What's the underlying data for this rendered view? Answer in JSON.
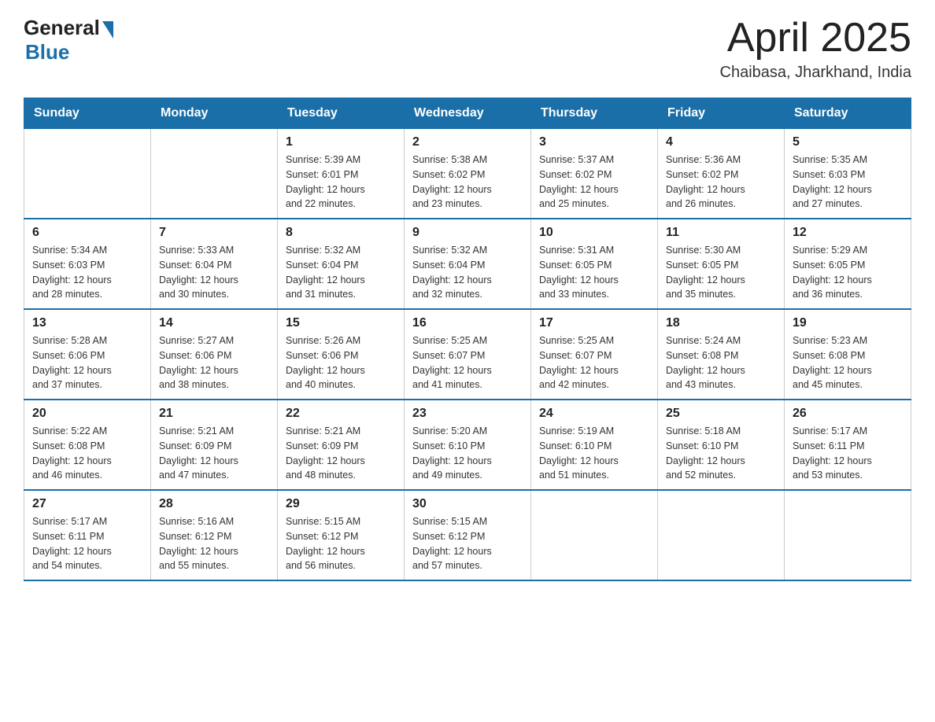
{
  "header": {
    "logo_general": "General",
    "logo_blue": "Blue",
    "month_year": "April 2025",
    "location": "Chaibasa, Jharkhand, India"
  },
  "weekdays": [
    "Sunday",
    "Monday",
    "Tuesday",
    "Wednesday",
    "Thursday",
    "Friday",
    "Saturday"
  ],
  "weeks": [
    [
      {
        "day": "",
        "info": ""
      },
      {
        "day": "",
        "info": ""
      },
      {
        "day": "1",
        "info": "Sunrise: 5:39 AM\nSunset: 6:01 PM\nDaylight: 12 hours\nand 22 minutes."
      },
      {
        "day": "2",
        "info": "Sunrise: 5:38 AM\nSunset: 6:02 PM\nDaylight: 12 hours\nand 23 minutes."
      },
      {
        "day": "3",
        "info": "Sunrise: 5:37 AM\nSunset: 6:02 PM\nDaylight: 12 hours\nand 25 minutes."
      },
      {
        "day": "4",
        "info": "Sunrise: 5:36 AM\nSunset: 6:02 PM\nDaylight: 12 hours\nand 26 minutes."
      },
      {
        "day": "5",
        "info": "Sunrise: 5:35 AM\nSunset: 6:03 PM\nDaylight: 12 hours\nand 27 minutes."
      }
    ],
    [
      {
        "day": "6",
        "info": "Sunrise: 5:34 AM\nSunset: 6:03 PM\nDaylight: 12 hours\nand 28 minutes."
      },
      {
        "day": "7",
        "info": "Sunrise: 5:33 AM\nSunset: 6:04 PM\nDaylight: 12 hours\nand 30 minutes."
      },
      {
        "day": "8",
        "info": "Sunrise: 5:32 AM\nSunset: 6:04 PM\nDaylight: 12 hours\nand 31 minutes."
      },
      {
        "day": "9",
        "info": "Sunrise: 5:32 AM\nSunset: 6:04 PM\nDaylight: 12 hours\nand 32 minutes."
      },
      {
        "day": "10",
        "info": "Sunrise: 5:31 AM\nSunset: 6:05 PM\nDaylight: 12 hours\nand 33 minutes."
      },
      {
        "day": "11",
        "info": "Sunrise: 5:30 AM\nSunset: 6:05 PM\nDaylight: 12 hours\nand 35 minutes."
      },
      {
        "day": "12",
        "info": "Sunrise: 5:29 AM\nSunset: 6:05 PM\nDaylight: 12 hours\nand 36 minutes."
      }
    ],
    [
      {
        "day": "13",
        "info": "Sunrise: 5:28 AM\nSunset: 6:06 PM\nDaylight: 12 hours\nand 37 minutes."
      },
      {
        "day": "14",
        "info": "Sunrise: 5:27 AM\nSunset: 6:06 PM\nDaylight: 12 hours\nand 38 minutes."
      },
      {
        "day": "15",
        "info": "Sunrise: 5:26 AM\nSunset: 6:06 PM\nDaylight: 12 hours\nand 40 minutes."
      },
      {
        "day": "16",
        "info": "Sunrise: 5:25 AM\nSunset: 6:07 PM\nDaylight: 12 hours\nand 41 minutes."
      },
      {
        "day": "17",
        "info": "Sunrise: 5:25 AM\nSunset: 6:07 PM\nDaylight: 12 hours\nand 42 minutes."
      },
      {
        "day": "18",
        "info": "Sunrise: 5:24 AM\nSunset: 6:08 PM\nDaylight: 12 hours\nand 43 minutes."
      },
      {
        "day": "19",
        "info": "Sunrise: 5:23 AM\nSunset: 6:08 PM\nDaylight: 12 hours\nand 45 minutes."
      }
    ],
    [
      {
        "day": "20",
        "info": "Sunrise: 5:22 AM\nSunset: 6:08 PM\nDaylight: 12 hours\nand 46 minutes."
      },
      {
        "day": "21",
        "info": "Sunrise: 5:21 AM\nSunset: 6:09 PM\nDaylight: 12 hours\nand 47 minutes."
      },
      {
        "day": "22",
        "info": "Sunrise: 5:21 AM\nSunset: 6:09 PM\nDaylight: 12 hours\nand 48 minutes."
      },
      {
        "day": "23",
        "info": "Sunrise: 5:20 AM\nSunset: 6:10 PM\nDaylight: 12 hours\nand 49 minutes."
      },
      {
        "day": "24",
        "info": "Sunrise: 5:19 AM\nSunset: 6:10 PM\nDaylight: 12 hours\nand 51 minutes."
      },
      {
        "day": "25",
        "info": "Sunrise: 5:18 AM\nSunset: 6:10 PM\nDaylight: 12 hours\nand 52 minutes."
      },
      {
        "day": "26",
        "info": "Sunrise: 5:17 AM\nSunset: 6:11 PM\nDaylight: 12 hours\nand 53 minutes."
      }
    ],
    [
      {
        "day": "27",
        "info": "Sunrise: 5:17 AM\nSunset: 6:11 PM\nDaylight: 12 hours\nand 54 minutes."
      },
      {
        "day": "28",
        "info": "Sunrise: 5:16 AM\nSunset: 6:12 PM\nDaylight: 12 hours\nand 55 minutes."
      },
      {
        "day": "29",
        "info": "Sunrise: 5:15 AM\nSunset: 6:12 PM\nDaylight: 12 hours\nand 56 minutes."
      },
      {
        "day": "30",
        "info": "Sunrise: 5:15 AM\nSunset: 6:12 PM\nDaylight: 12 hours\nand 57 minutes."
      },
      {
        "day": "",
        "info": ""
      },
      {
        "day": "",
        "info": ""
      },
      {
        "day": "",
        "info": ""
      }
    ]
  ]
}
